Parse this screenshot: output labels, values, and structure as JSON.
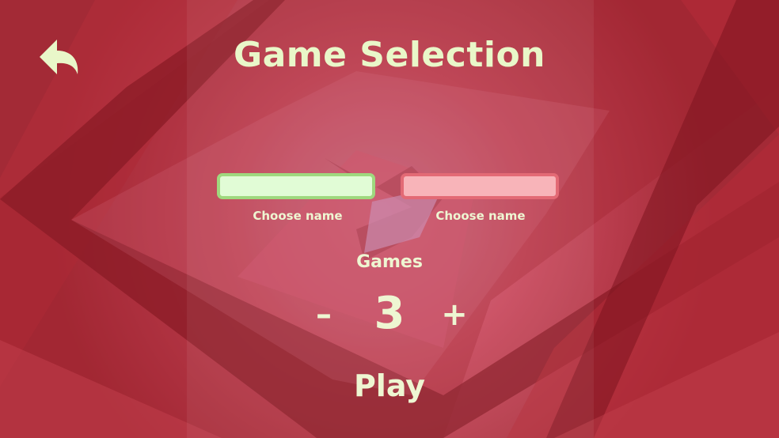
{
  "screen": {
    "title": "Game Selection"
  },
  "back_button": {
    "icon": "undo-arrow-icon"
  },
  "players": [
    {
      "value": "",
      "label": "Choose name",
      "color": "#9fd87e"
    },
    {
      "value": "",
      "label": "Choose name",
      "color": "#e36a75"
    }
  ],
  "games": {
    "label": "Games",
    "count": "3",
    "decrement": "–",
    "increment": "+"
  },
  "play_label": "Play",
  "colors": {
    "background": "#b5323f",
    "text": "#eef6d2",
    "player1_fill": "#e1fcd6",
    "player2_fill": "#f8b4b9"
  }
}
